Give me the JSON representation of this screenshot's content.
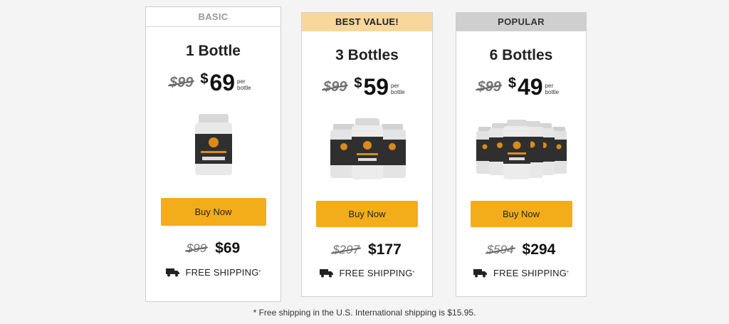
{
  "plans": [
    {
      "ribbon": "BASIC",
      "title": "1 Bottle",
      "old_price": "$99",
      "price_symbol": "$",
      "price_value": "69",
      "per_label_line1": "per",
      "per_label_line2": "bottle",
      "buy_label": "Buy Now",
      "total_old": "$99",
      "total_new": "$69",
      "shipping_label": "FREE SHIPPING",
      "shipping_mark": "*",
      "bottle_count": 1
    },
    {
      "ribbon": "BEST VALUE!",
      "title": "3 Bottles",
      "old_price": "$99",
      "price_symbol": "$",
      "price_value": "59",
      "per_label_line1": "per",
      "per_label_line2": "bottle",
      "buy_label": "Buy Now",
      "total_old": "$297",
      "total_new": "$177",
      "shipping_label": "FREE SHIPPING",
      "shipping_mark": "*",
      "bottle_count": 3
    },
    {
      "ribbon": "POPULAR",
      "title": "6 Bottles",
      "old_price": "$99",
      "price_symbol": "$",
      "price_value": "49",
      "per_label_line1": "per",
      "per_label_line2": "bottle",
      "buy_label": "Buy Now",
      "total_old": "$594",
      "total_new": "$294",
      "shipping_label": "FREE SHIPPING",
      "shipping_mark": "*",
      "bottle_count": 6
    }
  ],
  "footnote": "* Free shipping in the U.S. International shipping is $15.95.",
  "colors": {
    "button": "#f3ad1b",
    "best_ribbon": "#f8d79b",
    "popular_ribbon": "#cfcfcf",
    "bottle_body": "#e9e9e9",
    "bottle_label": "#2f2f2f",
    "bottle_emblem": "#d98a1c"
  },
  "icons": {
    "shipping": "truck-icon",
    "product": "supplement-bottle-icon"
  }
}
